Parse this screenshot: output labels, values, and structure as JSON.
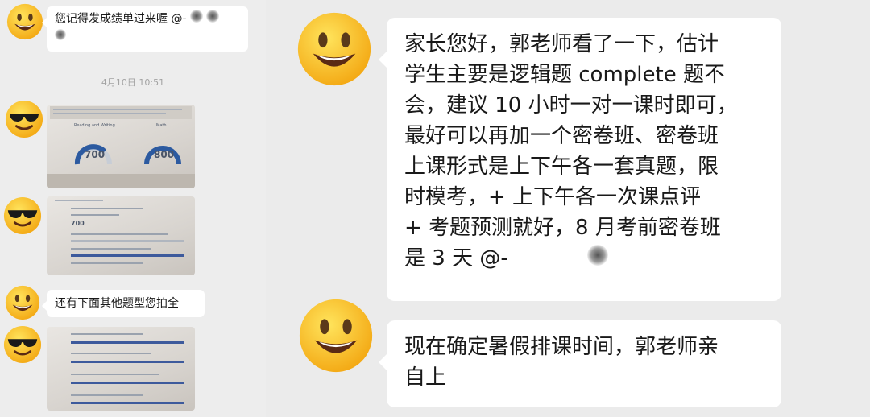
{
  "left_chat": {
    "msg1": {
      "text": "您记得发成绩单过来喔",
      "mention": "@-",
      "avatar": "smiley-icon"
    },
    "timestamp": "4月10日 10:51",
    "score_photo": {
      "avatar": "sunglasses-icon",
      "col1_title": "Reading and Writing",
      "col2_title": "Math",
      "score1": "700",
      "score2": "800",
      "accent_color": "#2c5aa0"
    },
    "detail_photo": {
      "avatar": "sunglasses-icon",
      "score": "700"
    },
    "msg2": {
      "text": "还有下面其他题型您拍全",
      "avatar": "smiley-icon"
    },
    "detail_photo2": {
      "avatar": "sunglasses-icon"
    }
  },
  "right_chat": {
    "msg1": {
      "avatar": "smiley-icon",
      "lines": [
        "家长您好，郭老师看了一下，估计",
        "学生主要是逻辑题 complete 题不",
        "会，建议 10 小时一对一课时即可，",
        "最好可以再加一个密卷班、密卷班",
        "上课形式是上下午各一套真题，限",
        "时模考，+ 上下午各一次课点评",
        "+ 考题预测就好，8 月考前密卷班",
        "是 3 天 @-"
      ]
    },
    "msg2": {
      "avatar": "smiley-icon",
      "lines": [
        "现在确定暑假排课时间，郭老师亲",
        "自上"
      ]
    }
  },
  "colors": {
    "bubble": "#ffffff",
    "background": "#ebebeb",
    "emoji_yellow": "#f7c21a"
  }
}
